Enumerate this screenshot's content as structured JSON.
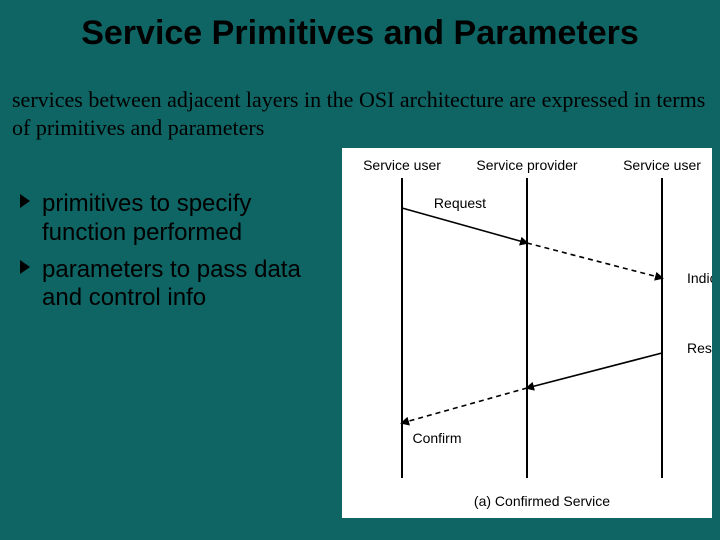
{
  "slide": {
    "title": "Service Primitives and Parameters",
    "subtitle": "services between adjacent layers in the OSI architecture are expressed in terms of primitives and parameters",
    "bullets": [
      {
        "text": "primitives to specify function performed"
      },
      {
        "text": "parameters to pass data and control info"
      }
    ]
  },
  "diagram": {
    "headers": {
      "left": "Service user",
      "center": "Service provider",
      "right": "Service user"
    },
    "arrows": {
      "request": "Request",
      "indication": "Indication",
      "response": "Response",
      "confirm": "Confirm"
    },
    "caption": "(a) Confirmed Service"
  }
}
